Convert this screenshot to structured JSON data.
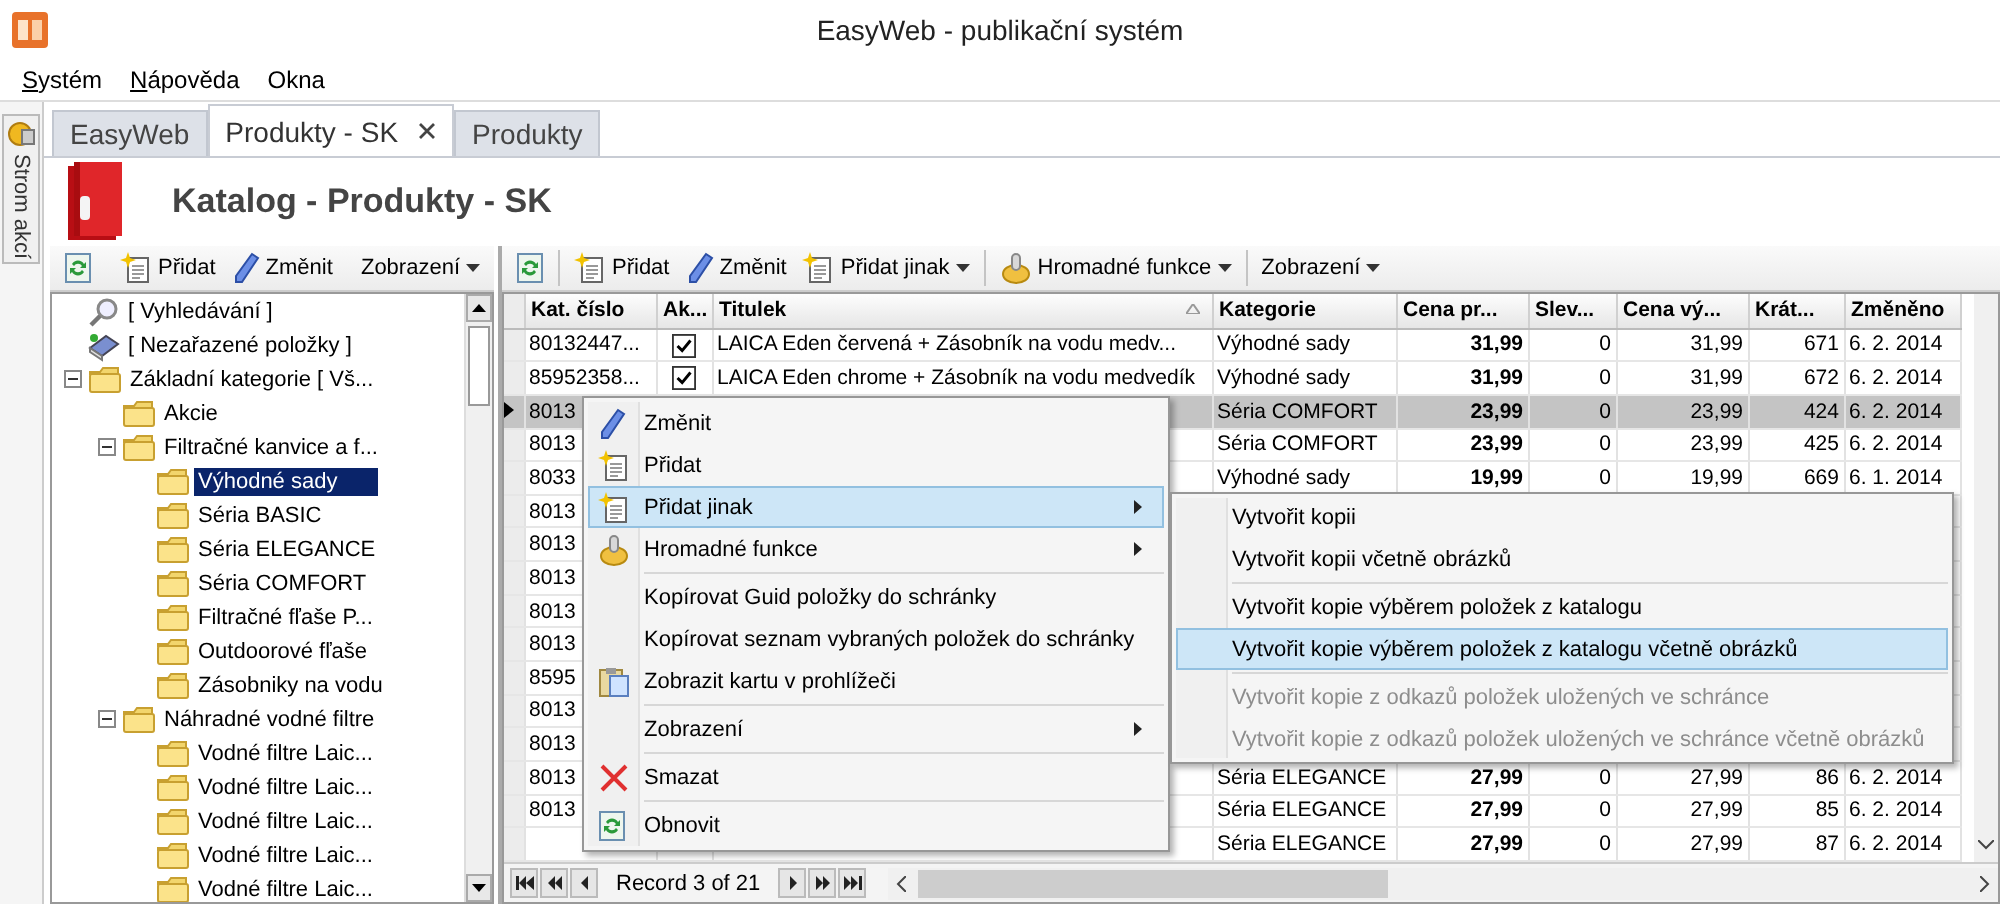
{
  "window": {
    "title": "EasyWeb - publikační systém"
  },
  "menu_bar": [
    {
      "label": "Systém",
      "access_key": true
    },
    {
      "label": "Nápověda",
      "access_key": true
    },
    {
      "label": "Okna",
      "access_key": false
    }
  ],
  "side_strip": {
    "label": "Strom akcí"
  },
  "tabs": [
    {
      "label": "EasyWeb",
      "selected": false,
      "closable": false
    },
    {
      "label": "Produkty - SK",
      "selected": true,
      "closable": true
    },
    {
      "label": "Produkty",
      "selected": false,
      "closable": false
    }
  ],
  "header": {
    "title": "Katalog - Produkty - SK"
  },
  "tree_toolbar": [
    {
      "kind": "refresh"
    },
    {
      "kind": "separator"
    },
    {
      "kind": "add",
      "label": "Přidat",
      "dropdown": false
    },
    {
      "kind": "edit",
      "label": "Změnit",
      "dropdown": false
    },
    {
      "kind": "separator"
    },
    {
      "kind": "plain",
      "label": "Zobrazení",
      "dropdown": true
    }
  ],
  "grid_toolbar": [
    {
      "kind": "refresh"
    },
    {
      "kind": "separator"
    },
    {
      "kind": "add",
      "label": "Přidat",
      "dropdown": false
    },
    {
      "kind": "edit",
      "label": "Změnit",
      "dropdown": false
    },
    {
      "kind": "add",
      "label": "Přidat jinak",
      "dropdown": true
    },
    {
      "kind": "separator"
    },
    {
      "kind": "bulk",
      "label": "Hromadné funkce",
      "dropdown": true
    },
    {
      "kind": "separator"
    },
    {
      "kind": "plain",
      "label": "Zobrazení",
      "dropdown": true
    }
  ],
  "tree": {
    "items": [
      {
        "label": "[ Vyhledávání ]",
        "kind": "search",
        "selected": false
      },
      {
        "label": "[ Nezařazené položky ]",
        "kind": "unsorted",
        "selected": false
      },
      {
        "label": "Základní kategorie  [ Vš...",
        "kind": "folder",
        "selected": false,
        "expanded": true,
        "children": [
          {
            "label": "Akcie",
            "kind": "folder",
            "selected": false
          },
          {
            "label": "Filtračné kanvice a f...",
            "kind": "folder",
            "selected": false,
            "expanded": true,
            "children": [
              {
                "label": "Výhodné sady",
                "kind": "folder",
                "selected": true
              },
              {
                "label": "Séria BASIC",
                "kind": "folder",
                "selected": false
              },
              {
                "label": "Séria ELEGANCE",
                "kind": "folder",
                "selected": false
              },
              {
                "label": "Séria COMFORT",
                "kind": "folder",
                "selected": false
              },
              {
                "label": "Filtračné fľaše P...",
                "kind": "folder",
                "selected": false
              },
              {
                "label": "Outdoorové fľaše",
                "kind": "folder",
                "selected": false
              },
              {
                "label": "Zásobniky na vodu",
                "kind": "folder",
                "selected": false
              }
            ]
          },
          {
            "label": "Náhradné vodné filtre",
            "kind": "folder",
            "selected": false,
            "expanded": true,
            "children": [
              {
                "label": "Vodné filtre Laic...",
                "kind": "folder",
                "selected": false
              },
              {
                "label": "Vodné filtre Laic...",
                "kind": "folder",
                "selected": false
              },
              {
                "label": "Vodné filtre Laic...",
                "kind": "folder",
                "selected": false
              },
              {
                "label": "Vodné filtre Laic...",
                "kind": "folder",
                "selected": false
              },
              {
                "label": "Vodné filtre Laic...",
                "kind": "folder",
                "selected": false
              }
            ]
          }
        ]
      }
    ]
  },
  "grid": {
    "columns": [
      {
        "label": "Kat. číslo",
        "kind": "text",
        "sorted": false
      },
      {
        "label": "Ak...",
        "kind": "check",
        "sorted": false
      },
      {
        "label": "Titulek",
        "kind": "text",
        "sorted": true
      },
      {
        "label": "Kategorie",
        "kind": "text",
        "sorted": false
      },
      {
        "label": "Cena pr...",
        "kind": "price",
        "sorted": false
      },
      {
        "label": "Slev...",
        "kind": "number",
        "sorted": false
      },
      {
        "label": "Cena vý...",
        "kind": "number",
        "sorted": false
      },
      {
        "label": "Krát...",
        "kind": "number",
        "sorted": false
      },
      {
        "label": "Změněno",
        "kind": "text",
        "sorted": false
      }
    ],
    "rows": [
      {
        "selected": false,
        "cells": [
          "80132447...",
          true,
          "LAICA Eden červená + Zásobník na vodu medv...",
          "Výhodné sady",
          "31,99",
          "0",
          "31,99",
          "671",
          "6. 2. 2014"
        ]
      },
      {
        "selected": false,
        "cells": [
          "85952358...",
          true,
          "LAICA Eden chrome + Zásobník na vodu medvedík",
          "Výhodné sady",
          "31,99",
          "0",
          "31,99",
          "672",
          "6. 2. 2014"
        ]
      },
      {
        "selected": true,
        "cells": [
          "8013",
          null,
          null,
          "Séria COMFORT",
          "23,99",
          "0",
          "23,99",
          "424",
          "6. 2. 2014"
        ]
      },
      {
        "selected": false,
        "cells": [
          "8013",
          null,
          null,
          "Séria COMFORT",
          "23,99",
          "0",
          "23,99",
          "425",
          "6. 2. 2014"
        ]
      },
      {
        "selected": false,
        "cells": [
          "8033",
          null,
          null,
          "Výhodné sady",
          "19,99",
          "0",
          "19,99",
          "669",
          "6. 1. 2014"
        ]
      },
      {
        "selected": false,
        "cells": [
          "8013"
        ]
      },
      {
        "selected": false,
        "cells": [
          "8013"
        ]
      },
      {
        "selected": false,
        "cells": [
          "8013"
        ]
      },
      {
        "selected": false,
        "cells": [
          "8013"
        ]
      },
      {
        "selected": false,
        "cells": [
          "8013"
        ]
      },
      {
        "selected": false,
        "cells": [
          "8595"
        ]
      },
      {
        "selected": false,
        "cells": [
          "8013"
        ]
      },
      {
        "selected": false,
        "cells": [
          "8013"
        ]
      },
      {
        "selected": false,
        "cells": [
          "8013",
          null,
          null,
          "Séria ELEGANCE",
          "27,99",
          "0",
          "27,99",
          "86",
          "6. 2. 2014"
        ]
      },
      {
        "selected": false,
        "cells": [
          "8013",
          null,
          null,
          "Séria ELEGANCE",
          "27,99",
          "0",
          "27,99",
          "85",
          "6. 2. 2014"
        ]
      },
      {
        "selected": false,
        "cells": [
          null,
          null,
          null,
          "Séria ELEGANCE",
          "27,99",
          "0",
          "27,99",
          "87",
          "6. 2. 2014"
        ]
      }
    ]
  },
  "navigator": {
    "record": "Record 3 of 21"
  },
  "context_menu": {
    "items": [
      {
        "kind": "edit",
        "label": "Změnit",
        "submenu": false,
        "selected": false
      },
      {
        "kind": "add",
        "label": "Přidat",
        "submenu": false,
        "selected": false
      },
      {
        "kind": "add",
        "label": "Přidat jinak",
        "submenu": true,
        "selected": true
      },
      {
        "kind": "bulk",
        "label": "Hromadné funkce",
        "submenu": true,
        "selected": false
      },
      {
        "kind": "separator"
      },
      {
        "kind": "plain",
        "label": "Kopírovat Guid položky do schránky",
        "submenu": false,
        "selected": false
      },
      {
        "kind": "plain",
        "label": "Kopírovat seznam vybraných položek do schránky",
        "submenu": false,
        "selected": false
      },
      {
        "kind": "clipboard",
        "label": "Zobrazit kartu v prohlížeči",
        "submenu": false,
        "selected": false
      },
      {
        "kind": "separator"
      },
      {
        "kind": "plain",
        "label": "Zobrazení",
        "submenu": true,
        "selected": false
      },
      {
        "kind": "separator"
      },
      {
        "kind": "delete",
        "label": "Smazat",
        "submenu": false,
        "selected": false
      },
      {
        "kind": "separator"
      },
      {
        "kind": "refresh",
        "label": "Obnovit",
        "submenu": false,
        "selected": false
      }
    ]
  },
  "submenu": {
    "items": [
      {
        "kind": "item",
        "label": "Vytvořit kopii",
        "disabled": false,
        "selected": false
      },
      {
        "kind": "item",
        "label": "Vytvořit kopii včetně obrázků",
        "disabled": false,
        "selected": false
      },
      {
        "kind": "separator"
      },
      {
        "kind": "item",
        "label": "Vytvořit kopie výběrem položek z katalogu",
        "disabled": false,
        "selected": false
      },
      {
        "kind": "item",
        "label": "Vytvořit kopie výběrem položek z katalogu včetně obrázků",
        "disabled": false,
        "selected": true
      },
      {
        "kind": "separator"
      },
      {
        "kind": "item",
        "label": "Vytvořit kopie z odkazů položek uložených ve schránce",
        "disabled": true,
        "selected": false
      },
      {
        "kind": "item",
        "label": "Vytvořit kopie z odkazů položek uložených ve schránce včetně obrázků",
        "disabled": true,
        "selected": false
      }
    ]
  }
}
